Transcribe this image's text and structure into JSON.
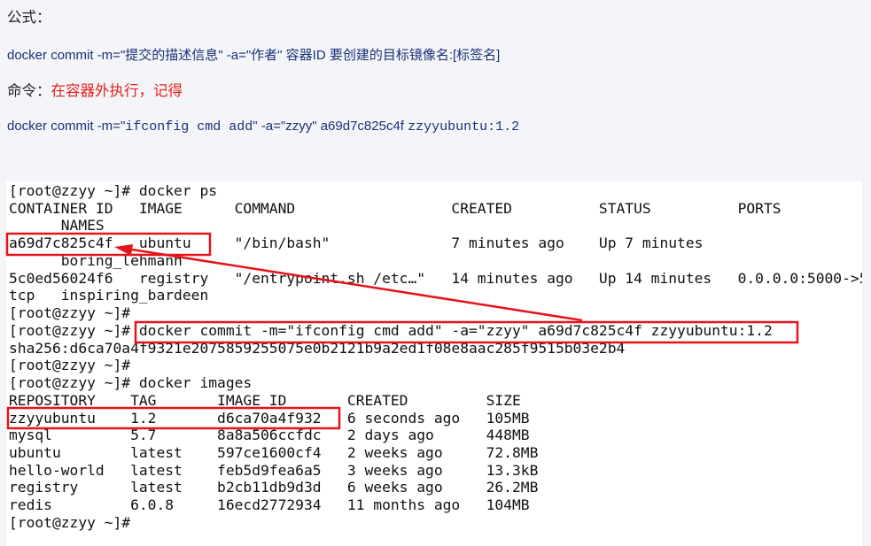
{
  "note": {
    "formula_label": "公式：",
    "formula_text": "docker commit -m=\"提交的描述信息\" -a=\"作者\" 容器ID 要创建的目标镜像名:[标签名]",
    "command_label": "命令：",
    "command_hint": "在容器外执行，记得",
    "command_example": {
      "prefix": "docker commit -m=\"",
      "message": "ifconfig cmd add",
      "middle": "\" -a=\"zzyy\" a69d7c825c4f ",
      "target": "zzyyubuntu:1.2"
    }
  },
  "terminal": {
    "lines": [
      "[root@zzyy ~]# docker ps",
      "CONTAINER ID   IMAGE      COMMAND                  CREATED          STATUS          PORTS",
      "      NAMES",
      "a69d7c825c4f   ubuntu     \"/bin/bash\"              7 minutes ago    Up 7 minutes",
      "      boring_lehmann",
      "5c0ed56024f6   registry   \"/entrypoint.sh /etc…\"   14 minutes ago   Up 14 minutes   0.0.0.0:5000->5",
      "tcp   inspiring_bardeen",
      "[root@zzyy ~]#",
      "[root@zzyy ~]# docker commit -m=\"ifconfig cmd add\" -a=\"zzyy\" a69d7c825c4f zzyyubuntu:1.2",
      "sha256:d6ca70a4f9321e2075859255075e0b2121b9a2ed1f08e8aac285f9515b03e2b4",
      "[root@zzyy ~]#",
      "[root@zzyy ~]# docker images",
      "REPOSITORY    TAG       IMAGE ID       CREATED         SIZE",
      "zzyyubuntu    1.2       d6ca70a4f932   6 seconds ago   105MB",
      "mysql         5.7       8a8a506ccfdc   2 days ago      448MB",
      "ubuntu        latest    597ce1600cf4   2 weeks ago     72.8MB",
      "hello-world   latest    feb5d9fea6a5   3 weeks ago     13.3kB",
      "registry      latest    b2cb11db9d3d   6 weeks ago     26.2MB",
      "redis         6.0.8     16ecd2772934   11 months ago   104MB",
      "[root@zzyy ~]#"
    ]
  },
  "colors": {
    "page_background": "#f4f5f8",
    "terminal_background": "#ffffff",
    "text_dark": "#222222",
    "text_navy": "#1a3079",
    "hint_red": "#e5201c",
    "annotation_red": "#e5141b",
    "terminal_text": "#111111"
  }
}
